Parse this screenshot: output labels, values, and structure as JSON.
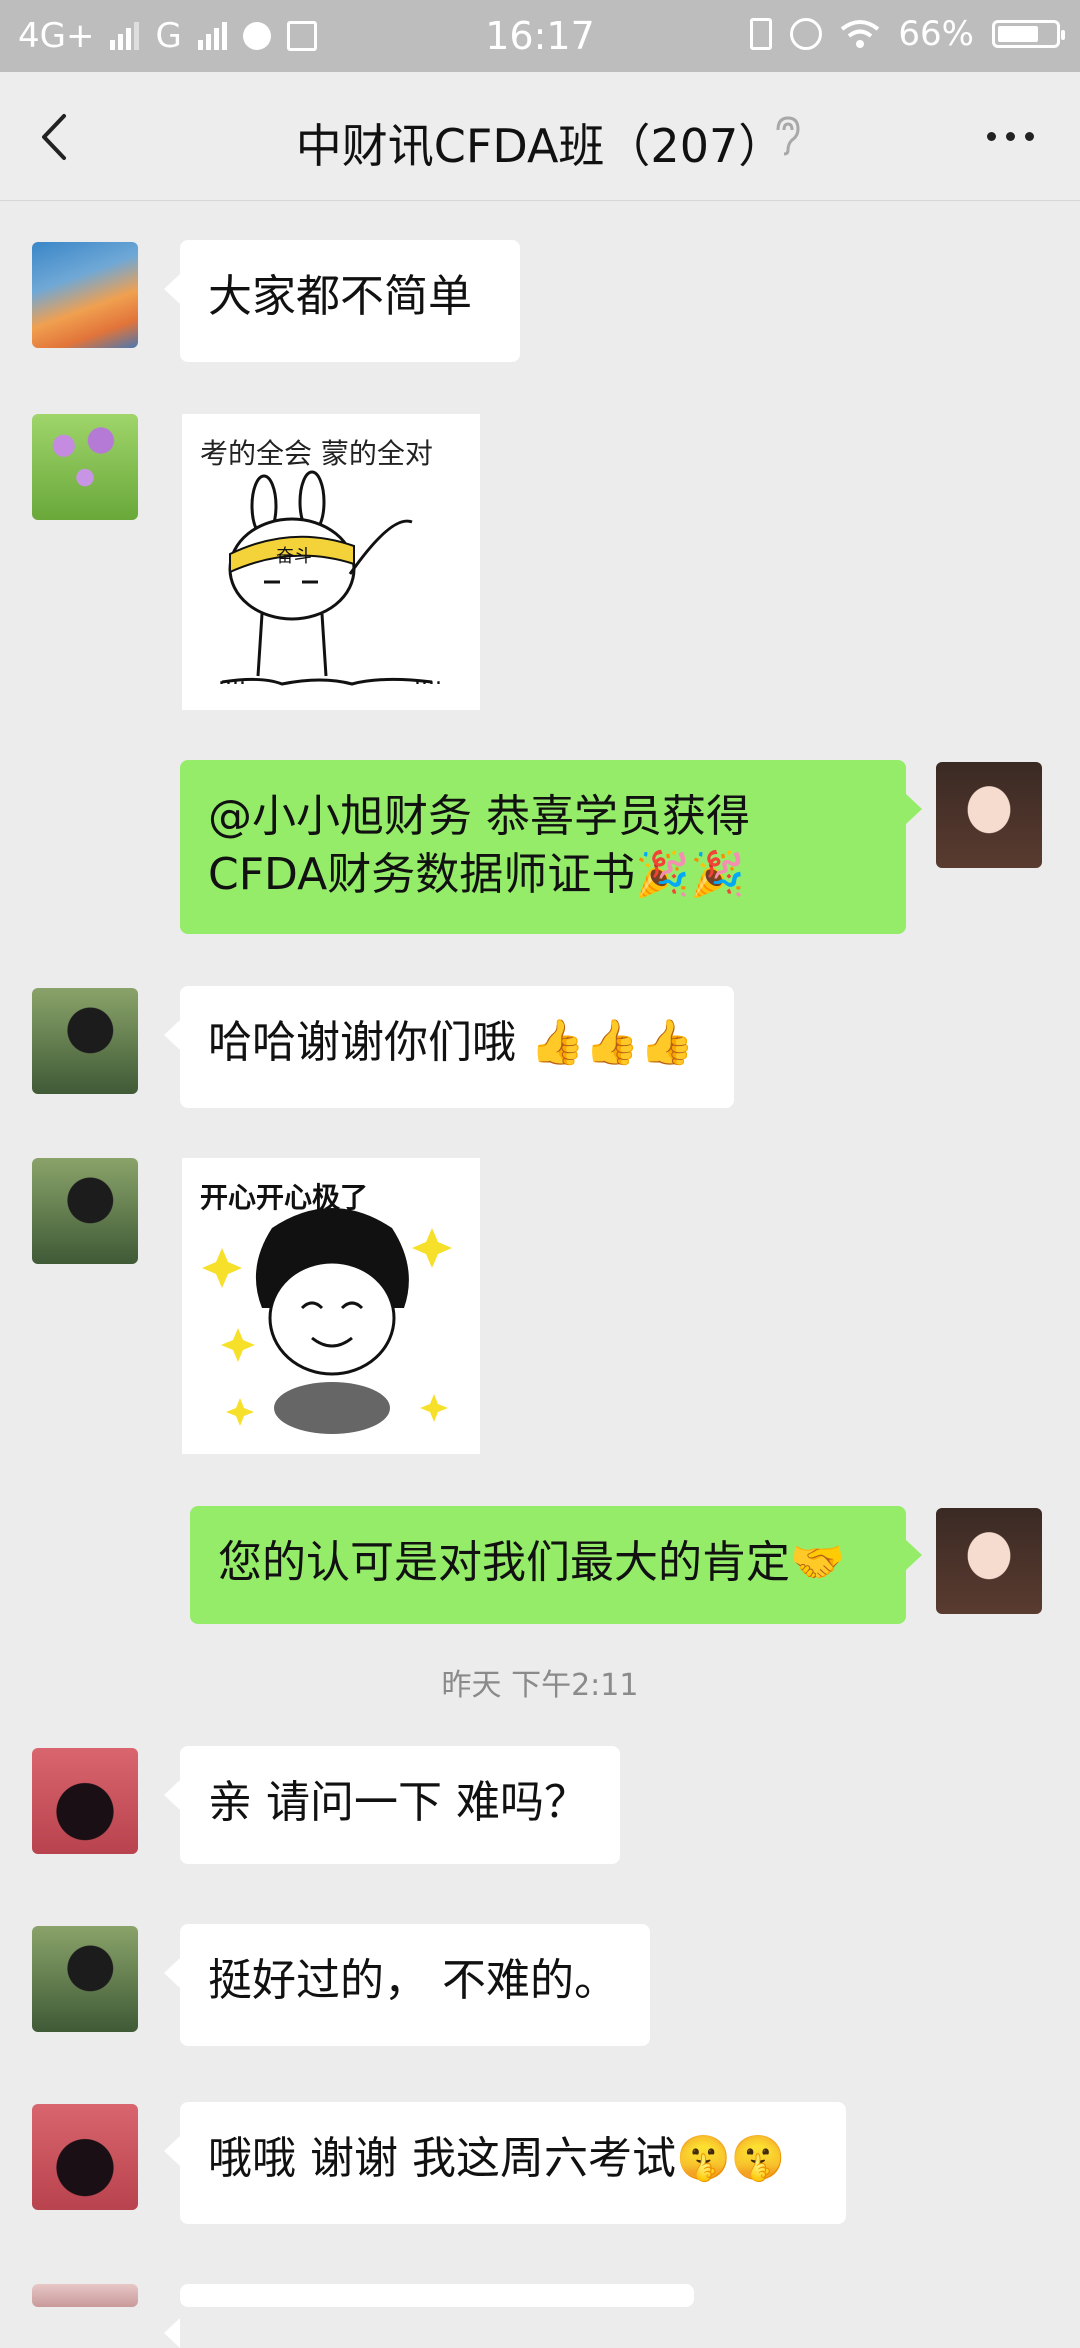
{
  "status": {
    "network": "4G+",
    "network2": "G",
    "time": "16:17",
    "battery": "66%"
  },
  "header": {
    "title": "中财讯CFDA班（207）"
  },
  "messages": {
    "m1": "大家都不简单",
    "m2_caption": "考的全会 蒙的全对",
    "m2_headband": "奋斗",
    "m3": "@小小旭财务 恭喜学员获得CFDA财务数据师证书🎉🎉",
    "m4": "哈哈谢谢你们哦 👍👍👍",
    "m5_caption": "开心开心极了",
    "m6": "您的认可是对我们最大的肯定🤝",
    "timestamp": "昨天 下午2:11",
    "m7": "亲 请问一下 难吗？",
    "m8": "挺好过的， 不难的。",
    "m9": "哦哦 谢谢 我这周六考试🤫🤫"
  },
  "colors": {
    "bubble_out": "#95ec69",
    "bubble_in": "#ffffff",
    "background": "#ececec",
    "statusbar": "#bdbdbd"
  }
}
